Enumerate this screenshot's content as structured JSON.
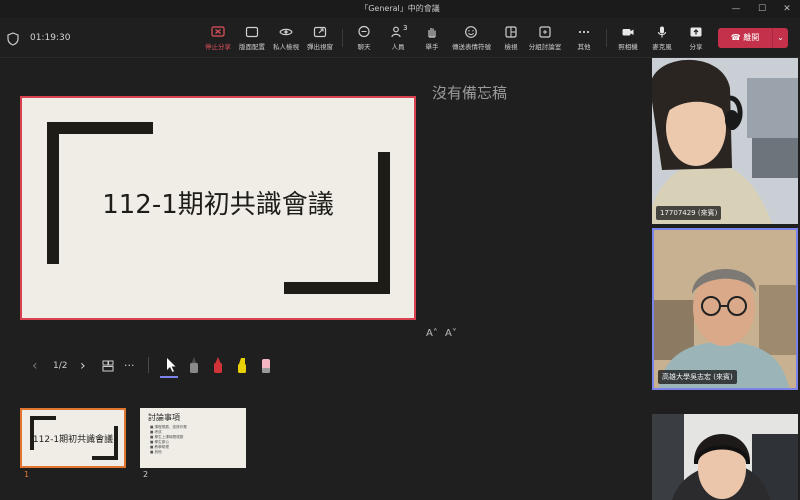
{
  "window": {
    "title": "「General」中的會議",
    "minimize": "—",
    "maximize": "☐",
    "close": "✕"
  },
  "meeting": {
    "timer": "01:19:30"
  },
  "toolbar": {
    "stop_share": "停止分享",
    "layout": "版面配置",
    "private_view": "私人檢視",
    "popout": "彈出視窗",
    "chat": "聊天",
    "people": "人員",
    "people_count": "3",
    "raise": "舉手",
    "react": "傳送表情符號",
    "view": "檢視",
    "rooms": "分組討論室",
    "more": "其他",
    "camera": "照相機",
    "mic": "麥克風",
    "share": "分享",
    "leave": "離開",
    "leave_caret": "⌄"
  },
  "slide": {
    "title": "112-1期初共識會議",
    "page_indicator": "1/2",
    "prev": "‹",
    "next": "›",
    "more": "···"
  },
  "notes": {
    "empty_text": "沒有備忘稿"
  },
  "font_controls": {
    "increase": "A˄",
    "decrease": "A˅"
  },
  "thumbnails": [
    {
      "number": "1",
      "title": "112-1期初共識會議"
    },
    {
      "number": "2",
      "title": "討論事項",
      "bullets": [
        "■ 課程規劃、檢核作業",
        "■ 考試",
        "■ 學生上課時間規劃",
        "■ 學生辦公",
        "■ 教學助理",
        "■ 其他"
      ]
    }
  ],
  "participants": [
    {
      "name": "17707429 (來賓)"
    },
    {
      "name": "高雄大學吳志宏 (來賓)"
    },
    {
      "name": ""
    }
  ],
  "colors": {
    "accent": "#7b83eb",
    "leave": "#c4314b",
    "active_share": "#e0525c",
    "selected_thumb": "#e0752f"
  }
}
